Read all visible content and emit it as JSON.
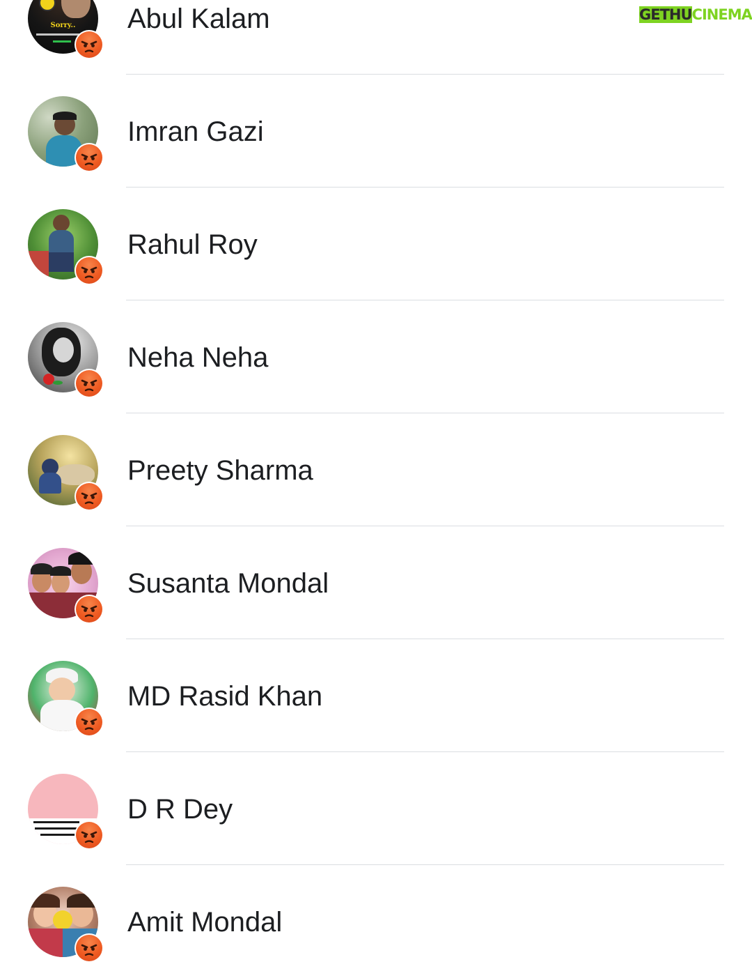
{
  "watermark": {
    "part1": "GETHU",
    "part2": "CINEMA"
  },
  "reaction_icon": "angry-reaction-icon",
  "colors": {
    "reaction": "#ef5b22",
    "divider": "#dadde1",
    "name_text": "#1c1e21",
    "watermark_green": "#7ed321"
  },
  "people": [
    {
      "name": "Abul Kalam",
      "avatar_text": "Sorry.."
    },
    {
      "name": "Imran Gazi"
    },
    {
      "name": "Rahul Roy"
    },
    {
      "name": "Neha Neha"
    },
    {
      "name": "Preety Sharma"
    },
    {
      "name": "Susanta Mondal"
    },
    {
      "name": "MD Rasid Khan"
    },
    {
      "name": "D R Dey"
    },
    {
      "name": "Amit Mondal"
    }
  ]
}
